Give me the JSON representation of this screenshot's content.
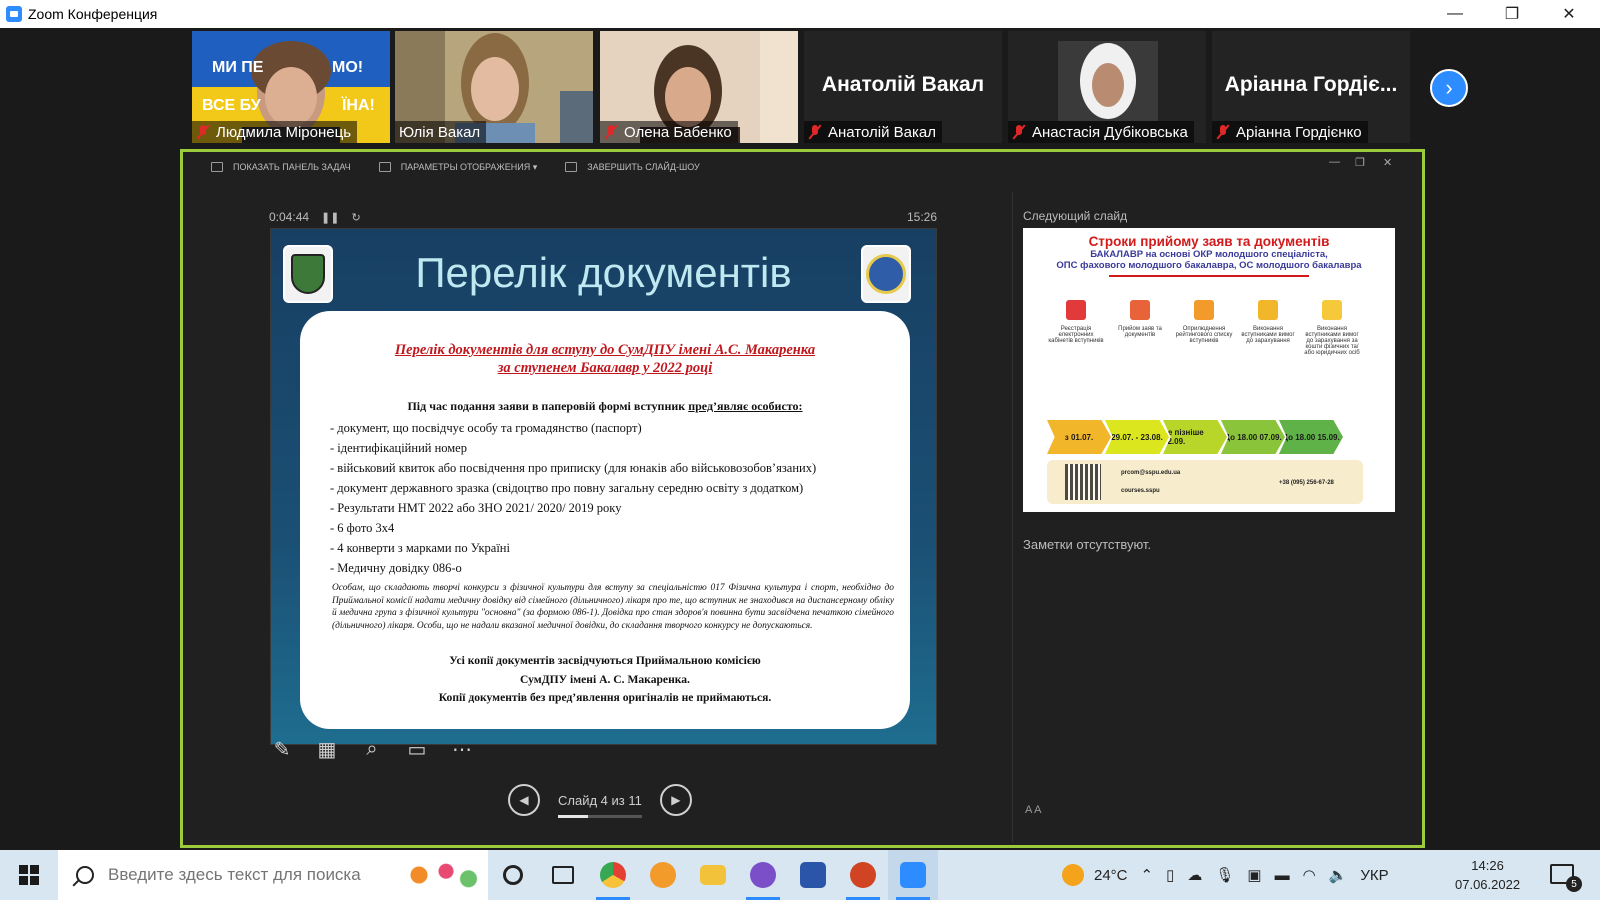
{
  "window": {
    "title": "Zoom Конференция",
    "controls": [
      "—",
      "❐",
      "✕"
    ]
  },
  "gallery": {
    "banner_top": "МИ ПЕ",
    "banner_top2": "МО!",
    "banner_bottom": "ВСЕ БУ",
    "banner_bottom2": "ЇНА!",
    "participants": [
      {
        "name": "Людмила Міронець",
        "muted": true,
        "video": true,
        "active": false
      },
      {
        "name": "Юлія Вакал",
        "muted": false,
        "video": true,
        "active": true
      },
      {
        "name": "Олена Бабенко",
        "muted": true,
        "video": true,
        "active": false
      },
      {
        "name": "Анатолій Вакал",
        "display": "Анатолій Вакал",
        "muted": true,
        "video": false,
        "active": false
      },
      {
        "name": "Анастасія Дубіковська",
        "muted": true,
        "video": true,
        "active": false
      },
      {
        "name": "Аріанна Гордієнко",
        "display": "Аріанна Гордіє...",
        "muted": true,
        "video": false,
        "active": false
      }
    ]
  },
  "presenter": {
    "toolbar": [
      "ПОКАЗАТЬ ПАНЕЛЬ ЗАДАЧ",
      "ПАРАМЕТРЫ ОТОБРАЖЕНИЯ ▾",
      "ЗАВЕРШИТЬ СЛАЙД-ШОУ"
    ],
    "elapsed": "0:04:44",
    "clock": "15:26",
    "next_label": "Следующий слайд",
    "notes": "Заметки отсутствуют.",
    "slide_counter": "Слайд 4 из 11",
    "progress": 0.36,
    "font_controls": "A  A"
  },
  "slide": {
    "title": "Перелік документів",
    "heading_line1": "Перелік документів для вступу до СумДПУ імені А.С. Макаренка",
    "heading_line2": "за ступенем Бакалавр у 2022 році",
    "lead_text": "Під час подання заяви в паперовій формі вступник ",
    "lead_underlined": "пред’являє особисто:",
    "items": [
      "документ, що посвідчує особу та громадянство (паспорт)",
      "ідентифікаційний номер",
      "військовий квиток або посвідчення про приписку (для юнаків або військовозобов’язаних)",
      "документ державного зразка (свідоцтво про повну загальну середню освіту з додатком)",
      "Результати НМТ 2022 або ЗНО 2021/ 2020/ 2019 року",
      "6 фото 3х4",
      "4 конверти з марками по Україні",
      "Медичну довідку 086-о"
    ],
    "note": "Особам, що складають творчі конкурси з фізичної культури для вступу за спеціальністю 017 Фізична культура і спорт, необхідно до Приймальної комісії надати медичну довідку від сімейного (дільничного) лікаря про те, що вступник не знаходився на диспансерному обліку й медична група з фізичної культури \"основна\" (за формою 086-1). Довідка про стан здоров'я повинна бути засвідчена печаткою сімейного (дільничного) лікаря. Особи, що не надали вказаної медичної довідки, до складання творчого конкурсу не допускаються.",
    "footer_line1": "Усі копії документів засвідчуються Приймальною комісією",
    "footer_line2": "СумДПУ імені А. С. Макаренка.",
    "footer_line3": "Копії документів без пред’явлення оригіналів не приймаються."
  },
  "next_slide": {
    "title": "Строки прийому заяв та документів",
    "subtitle1": "БАКАЛАВР на основі ОКР молодшого спеціаліста,",
    "subtitle2": "ОПС фахового молодшого бакалавра, ОС молодшого бакалавра",
    "columns": [
      {
        "label": "Реєстрація електронних кабінетів вступників",
        "date": "з 01.07.",
        "color": "#e23a3a"
      },
      {
        "label": "Прийом заяв та документів",
        "date": "29.07. - 23.08.",
        "color": "#e8623a"
      },
      {
        "label": "Оприлюднення рейтингового списку вступників",
        "date": "не пізніше 02.09.",
        "color": "#f29a2a"
      },
      {
        "label": "Виконання вступниками вимог до зарахування",
        "date": "До 18.00 07.09.",
        "color": "#f2b62a"
      },
      {
        "label": "Виконання вступниками вимог до зарахування за кошти фізичних та/або юридичних осіб",
        "date": "До 18.00 15.09.",
        "color": "#f5c93a"
      }
    ],
    "email": "prcom@sspu.edu.ua",
    "site": "courses.sspu",
    "phone": "+38 (095) 256-67-28"
  },
  "taskbar": {
    "search_placeholder": "Введите здесь текст для поиска",
    "weather": "24°C",
    "language": "УКР",
    "time": "14:26",
    "date": "07.06.2022",
    "notifications": "5",
    "apps": [
      {
        "name": "cortana-icon",
        "color": "#222"
      },
      {
        "name": "task-view-icon",
        "color": "#222"
      },
      {
        "name": "chrome-icon",
        "color": "#e34133"
      },
      {
        "name": "browser-icon",
        "color": "#f29a2a"
      },
      {
        "name": "file-explorer-icon",
        "color": "#f2c33a"
      },
      {
        "name": "viber-icon",
        "color": "#7b4fc8"
      },
      {
        "name": "save-app-icon",
        "color": "#2a55a8"
      },
      {
        "name": "powerpoint-icon",
        "color": "#d04423"
      },
      {
        "name": "zoom-icon",
        "color": "#2d8cff"
      }
    ]
  }
}
